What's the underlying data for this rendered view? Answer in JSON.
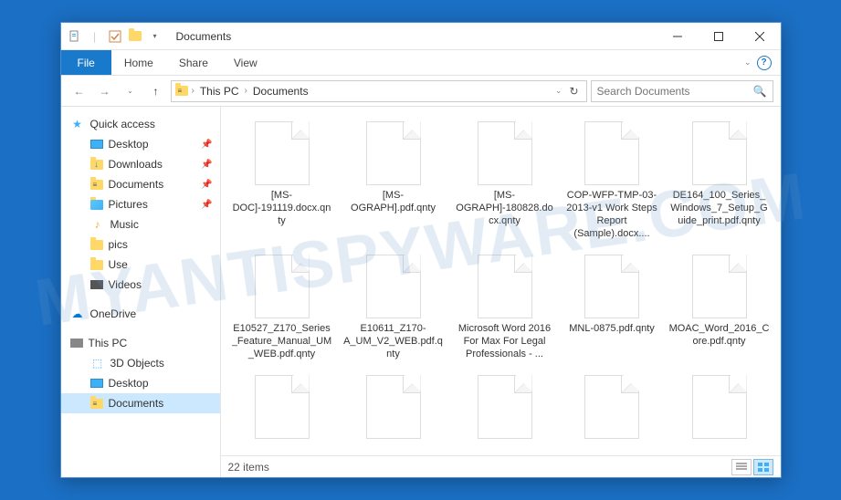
{
  "window_title": "Documents",
  "ribbon": {
    "file": "File",
    "home": "Home",
    "share": "Share",
    "view": "View"
  },
  "breadcrumb": {
    "root": "This PC",
    "current": "Documents"
  },
  "search": {
    "placeholder": "Search Documents"
  },
  "sidebar": {
    "quick_access": "Quick access",
    "desktop": "Desktop",
    "downloads": "Downloads",
    "documents": "Documents",
    "pictures": "Pictures",
    "music": "Music",
    "pics": "pics",
    "use": "Use",
    "videos": "Videos",
    "onedrive": "OneDrive",
    "this_pc": "This PC",
    "objects3d": "3D Objects",
    "desktop2": "Desktop",
    "documents2": "Documents"
  },
  "files": [
    "[MS-DOC]-191119.docx.qnty",
    "[MS-OGRAPH].pdf.qnty",
    "[MS-OGRAPH]-180828.docx.qnty",
    "COP-WFP-TMP-03-2013-v1 Work Steps Report (Sample).docx....",
    "DE164_100_Series_Windows_7_Setup_Guide_print.pdf.qnty",
    "E10527_Z170_Series_Feature_Manual_UM_WEB.pdf.qnty",
    "E10611_Z170-A_UM_V2_WEB.pdf.qnty",
    "Microsoft Word 2016 For Max For Legal Professionals - ...",
    "MNL-0875.pdf.qnty",
    "MOAC_Word_2016_Core.pdf.qnty",
    "",
    "",
    "",
    "",
    ""
  ],
  "status": {
    "count": "22 items"
  },
  "watermark": "MYANTISPYWARE.COM"
}
